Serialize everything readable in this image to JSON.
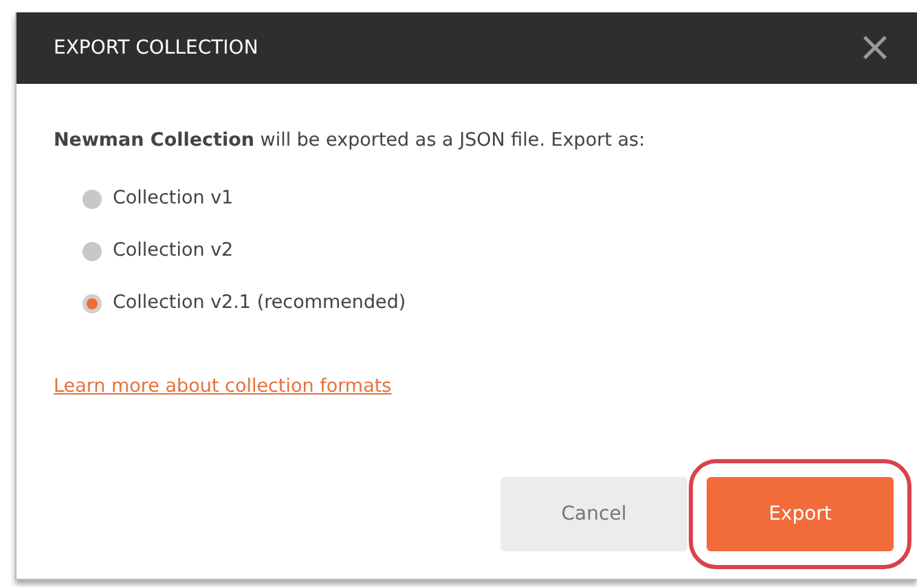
{
  "dialog": {
    "title": "EXPORT COLLECTION",
    "close": "×"
  },
  "message": "**Newman Collection** will be exported as a JSON file. Export as:",
  "options": [
    {
      "label": "Collection v1",
      "selected": false
    },
    {
      "label": "Collection v2",
      "selected": false
    },
    {
      "label": "Collection v2.1 (recommended)",
      "selected": true
    }
  ],
  "link": "Learn more about collection formats",
  "buttons": [
    {
      "label": "Cancel",
      "kind": "secondary",
      "highlighted": false
    },
    {
      "label": "Export",
      "kind": "primary",
      "highlighted": true
    }
  ]
}
